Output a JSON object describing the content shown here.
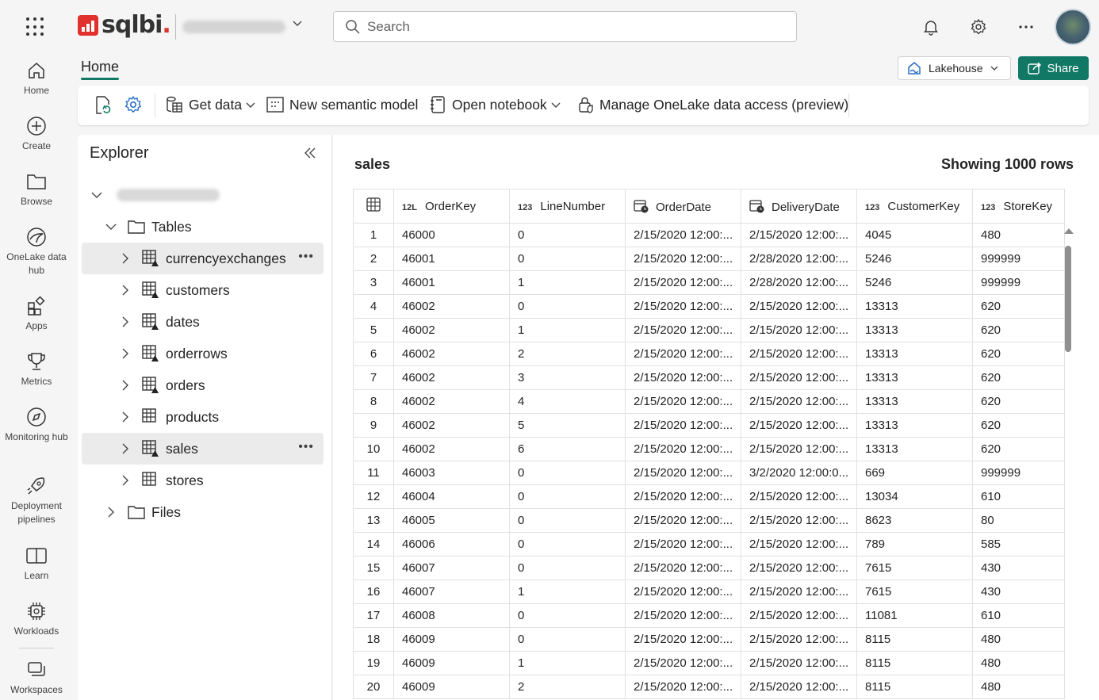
{
  "topbar": {
    "brand": "sqlbi",
    "search_placeholder": "Search",
    "icons": [
      "waffle-icon",
      "bell-icon",
      "gear-icon",
      "more-icon",
      "avatar"
    ]
  },
  "nav": {
    "items": [
      {
        "label": "Home",
        "icon": "home-icon"
      },
      {
        "label": "Create",
        "icon": "plus-circle-icon"
      },
      {
        "label": "Browse",
        "icon": "folder-icon"
      },
      {
        "label": "OneLake data hub",
        "icon": "onelake-icon"
      },
      {
        "label": "Apps",
        "icon": "apps-icon"
      },
      {
        "label": "Metrics",
        "icon": "trophy-icon"
      },
      {
        "label": "Monitoring hub",
        "icon": "compass-icon"
      },
      {
        "label": "Deployment pipelines",
        "icon": "rocket-icon"
      },
      {
        "label": "Learn",
        "icon": "book-icon"
      },
      {
        "label": "Workloads",
        "icon": "chip-icon"
      },
      {
        "label": "Workspaces",
        "icon": "workspaces-icon"
      }
    ]
  },
  "header": {
    "tab": "Home",
    "lakehouse_label": "Lakehouse",
    "share_label": "Share"
  },
  "ribbon": {
    "get_data": "Get data",
    "new_semantic_model": "New semantic model",
    "open_notebook": "Open notebook",
    "manage_access": "Manage OneLake data access (preview)"
  },
  "explorer": {
    "title": "Explorer",
    "tables_label": "Tables",
    "files_label": "Files",
    "tables": [
      "currencyexchanges",
      "customers",
      "dates",
      "orderrows",
      "orders",
      "products",
      "sales",
      "stores"
    ],
    "selected_table": "sales"
  },
  "grid": {
    "title": "sales",
    "row_count_text": "Showing 1000 rows",
    "columns": [
      {
        "name": "OrderKey",
        "type": "12L"
      },
      {
        "name": "LineNumber",
        "type": "123"
      },
      {
        "name": "OrderDate",
        "type": "date"
      },
      {
        "name": "DeliveryDate",
        "type": "date"
      },
      {
        "name": "CustomerKey",
        "type": "123"
      },
      {
        "name": "StoreKey",
        "type": "123"
      }
    ],
    "rows": [
      [
        "1",
        "46000",
        "0",
        "2/15/2020 12:00:...",
        "2/15/2020 12:00:...",
        "4045",
        "480"
      ],
      [
        "2",
        "46001",
        "0",
        "2/15/2020 12:00:...",
        "2/28/2020 12:00:...",
        "5246",
        "999999"
      ],
      [
        "3",
        "46001",
        "1",
        "2/15/2020 12:00:...",
        "2/28/2020 12:00:...",
        "5246",
        "999999"
      ],
      [
        "4",
        "46002",
        "0",
        "2/15/2020 12:00:...",
        "2/15/2020 12:00:...",
        "13313",
        "620"
      ],
      [
        "5",
        "46002",
        "1",
        "2/15/2020 12:00:...",
        "2/15/2020 12:00:...",
        "13313",
        "620"
      ],
      [
        "6",
        "46002",
        "2",
        "2/15/2020 12:00:...",
        "2/15/2020 12:00:...",
        "13313",
        "620"
      ],
      [
        "7",
        "46002",
        "3",
        "2/15/2020 12:00:...",
        "2/15/2020 12:00:...",
        "13313",
        "620"
      ],
      [
        "8",
        "46002",
        "4",
        "2/15/2020 12:00:...",
        "2/15/2020 12:00:...",
        "13313",
        "620"
      ],
      [
        "9",
        "46002",
        "5",
        "2/15/2020 12:00:...",
        "2/15/2020 12:00:...",
        "13313",
        "620"
      ],
      [
        "10",
        "46002",
        "6",
        "2/15/2020 12:00:...",
        "2/15/2020 12:00:...",
        "13313",
        "620"
      ],
      [
        "11",
        "46003",
        "0",
        "2/15/2020 12:00:...",
        "3/2/2020 12:00:0...",
        "669",
        "999999"
      ],
      [
        "12",
        "46004",
        "0",
        "2/15/2020 12:00:...",
        "2/15/2020 12:00:...",
        "13034",
        "610"
      ],
      [
        "13",
        "46005",
        "0",
        "2/15/2020 12:00:...",
        "2/15/2020 12:00:...",
        "8623",
        "80"
      ],
      [
        "14",
        "46006",
        "0",
        "2/15/2020 12:00:...",
        "2/15/2020 12:00:...",
        "789",
        "585"
      ],
      [
        "15",
        "46007",
        "0",
        "2/15/2020 12:00:...",
        "2/15/2020 12:00:...",
        "7615",
        "430"
      ],
      [
        "16",
        "46007",
        "1",
        "2/15/2020 12:00:...",
        "2/15/2020 12:00:...",
        "7615",
        "430"
      ],
      [
        "17",
        "46008",
        "0",
        "2/15/2020 12:00:...",
        "2/15/2020 12:00:...",
        "11081",
        "610"
      ],
      [
        "18",
        "46009",
        "0",
        "2/15/2020 12:00:...",
        "2/15/2020 12:00:...",
        "8115",
        "480"
      ],
      [
        "19",
        "46009",
        "1",
        "2/15/2020 12:00:...",
        "2/15/2020 12:00:...",
        "8115",
        "480"
      ],
      [
        "20",
        "46009",
        "2",
        "2/15/2020 12:00:...",
        "2/15/2020 12:00:...",
        "8115",
        "480"
      ]
    ]
  },
  "colors": {
    "accent": "#117865",
    "brand_red": "#e0312e"
  }
}
